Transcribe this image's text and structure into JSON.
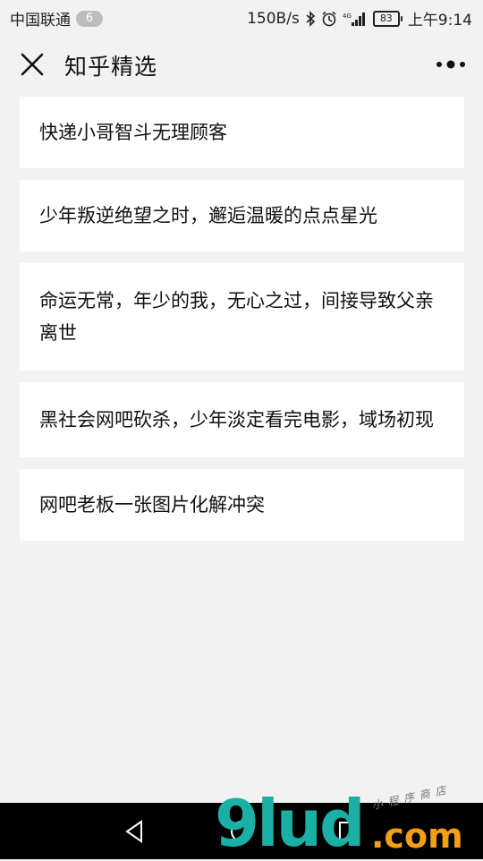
{
  "status_bar": {
    "carrier": "中国联通",
    "notification_count": "6",
    "net_speed": "150B/s",
    "network": "4G",
    "battery": "83",
    "time": "上午9:14"
  },
  "nav": {
    "title": "知乎精选"
  },
  "articles": [
    {
      "title": "快递小哥智斗无理顾客"
    },
    {
      "title": "少年叛逆绝望之时，邂逅温暖的点点星光"
    },
    {
      "title": "命运无常，年少的我，无心之过，间接导致父亲离世"
    },
    {
      "title": "黑社会网吧砍杀，少年淡定看完电影，域场初现"
    },
    {
      "title": "网吧老板一张图片化解冲突"
    }
  ],
  "watermark": {
    "logo": "9lud",
    "suffix": ".com",
    "tagline": "小程序商店"
  },
  "colors": {
    "background": "#f2f2f2",
    "card": "#ffffff",
    "text": "#111111",
    "watermark_teal": "#1bb0a6",
    "watermark_orange": "#f2a012"
  },
  "icons": {
    "close": "close-icon",
    "more": "more-icon",
    "back": "back-triangle-icon",
    "home": "home-circle-icon",
    "recents": "recents-square-icon"
  }
}
